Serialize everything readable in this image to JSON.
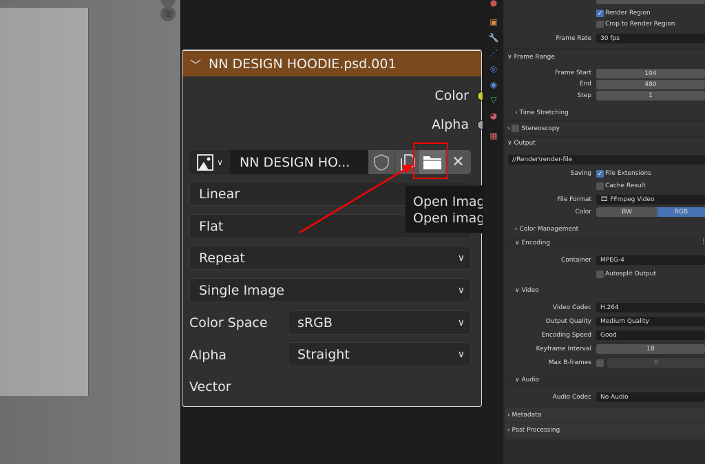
{
  "node": {
    "title": "NN DESIGN HOODIE.psd.001",
    "header_color": "#7a4a1e",
    "outputs": [
      {
        "label": "Color",
        "socket_color": "#c7c729"
      },
      {
        "label": "Alpha",
        "socket_color": "#a1a1a1"
      }
    ],
    "image_name": "NN DESIGN HO...",
    "interpolation": "Linear",
    "projection": "Flat",
    "extension": "Repeat",
    "source": "Single Image",
    "color_space_label": "Color Space",
    "color_space": "sRGB",
    "alpha_label": "Alpha",
    "alpha_mode": "Straight",
    "vector_label": "Vector"
  },
  "tooltip": {
    "title": "Open Image",
    "description": "Open image."
  },
  "annotation": {
    "color": "#ff0000"
  },
  "properties": {
    "render_region": "Render Region",
    "render_region_checked": true,
    "crop_region": "Crop to Render Region",
    "crop_region_checked": false,
    "frame_rate_label": "Frame Rate",
    "frame_rate": "30 fps",
    "frame_range": {
      "title": "Frame Range",
      "start_label": "Frame Start",
      "start": "104",
      "end_label": "End",
      "end": "480",
      "step_label": "Step",
      "step": "1",
      "time_stretching": "Time Stretching"
    },
    "stereoscopy": "Stereoscopy",
    "output": {
      "title": "Output",
      "path": "//Render\\render-file",
      "saving_label": "Saving",
      "file_extensions": "File Extensions",
      "file_extensions_checked": true,
      "cache_result": "Cache Result",
      "cache_result_checked": false,
      "file_format_label": "File Format",
      "file_format": "FFmpeg Video",
      "color_label": "Color",
      "color_options": [
        "BW",
        "RGB"
      ],
      "color_selected": "RGB",
      "color_management": "Color Management"
    },
    "encoding": {
      "title": "Encoding",
      "container_label": "Container",
      "container": "MPEG-4",
      "autosplit": "Autosplit Output",
      "autosplit_checked": false
    },
    "video": {
      "title": "Video",
      "codec_label": "Video Codec",
      "codec": "H.264",
      "quality_label": "Output Quality",
      "quality": "Medium Quality",
      "speed_label": "Encoding Speed",
      "speed": "Good",
      "keyframe_label": "Keyframe Interval",
      "keyframe": "18",
      "bframes_label": "Max B-frames",
      "bframes": "0",
      "bframes_checked": false
    },
    "audio": {
      "title": "Audio",
      "codec_label": "Audio Codec",
      "codec": "No Audio"
    },
    "metadata": "Metadata",
    "post_processing": "Post Processing",
    "accent_color": "#4772b3"
  }
}
